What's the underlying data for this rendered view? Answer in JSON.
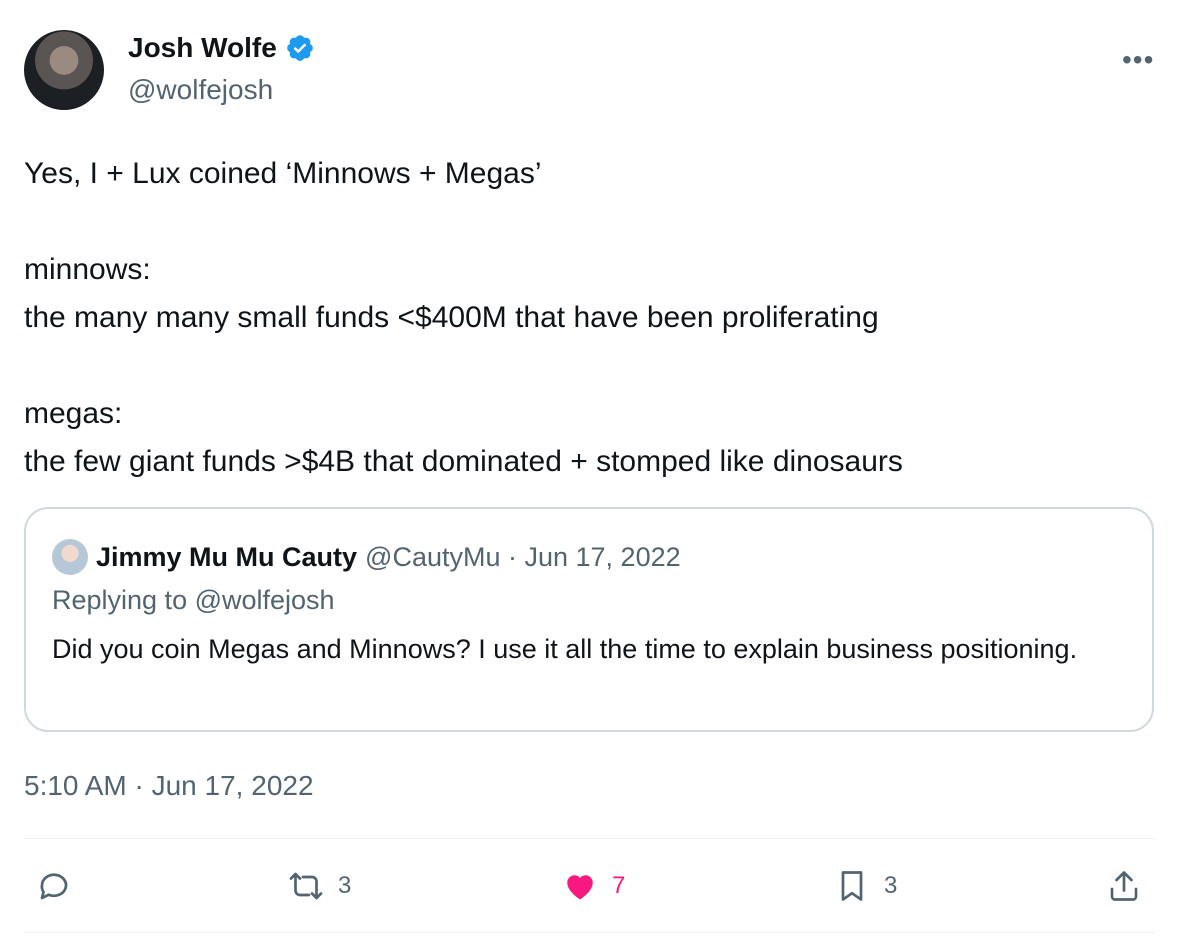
{
  "author": {
    "name": "Josh Wolfe",
    "handle": "@wolfejosh",
    "verified_icon": "verified-badge-icon"
  },
  "more_label": "•••",
  "tweet": {
    "lines": [
      "Yes, I + Lux coined ‘Minnows + Megas’",
      "",
      "minnows:",
      "the many many small funds <$400M that have been proliferating",
      "",
      "megas:",
      "the few giant funds >$4B that dominated + stomped like dinosaurs"
    ]
  },
  "quote": {
    "name": "Jimmy Mu Mu Cauty",
    "meta": "@CautyMu · Jun 17, 2022",
    "replying": "Replying to @wolfejosh",
    "body": "Did you coin Megas and Minnows? I use it all the time to explain business positioning."
  },
  "timestamp": "5:10 AM · Jun 17, 2022",
  "actions": {
    "reply": {
      "icon": "reply-icon",
      "count": ""
    },
    "retweet": {
      "icon": "retweet-icon",
      "count": "3"
    },
    "like": {
      "icon": "heart-icon",
      "count": "7",
      "color": "#f91880"
    },
    "bookmark": {
      "icon": "bookmark-icon",
      "count": "3"
    },
    "share": {
      "icon": "share-icon",
      "count": ""
    }
  },
  "colors": {
    "verified": "#1d9bf0",
    "muted": "#536471",
    "text": "#0f1419"
  }
}
